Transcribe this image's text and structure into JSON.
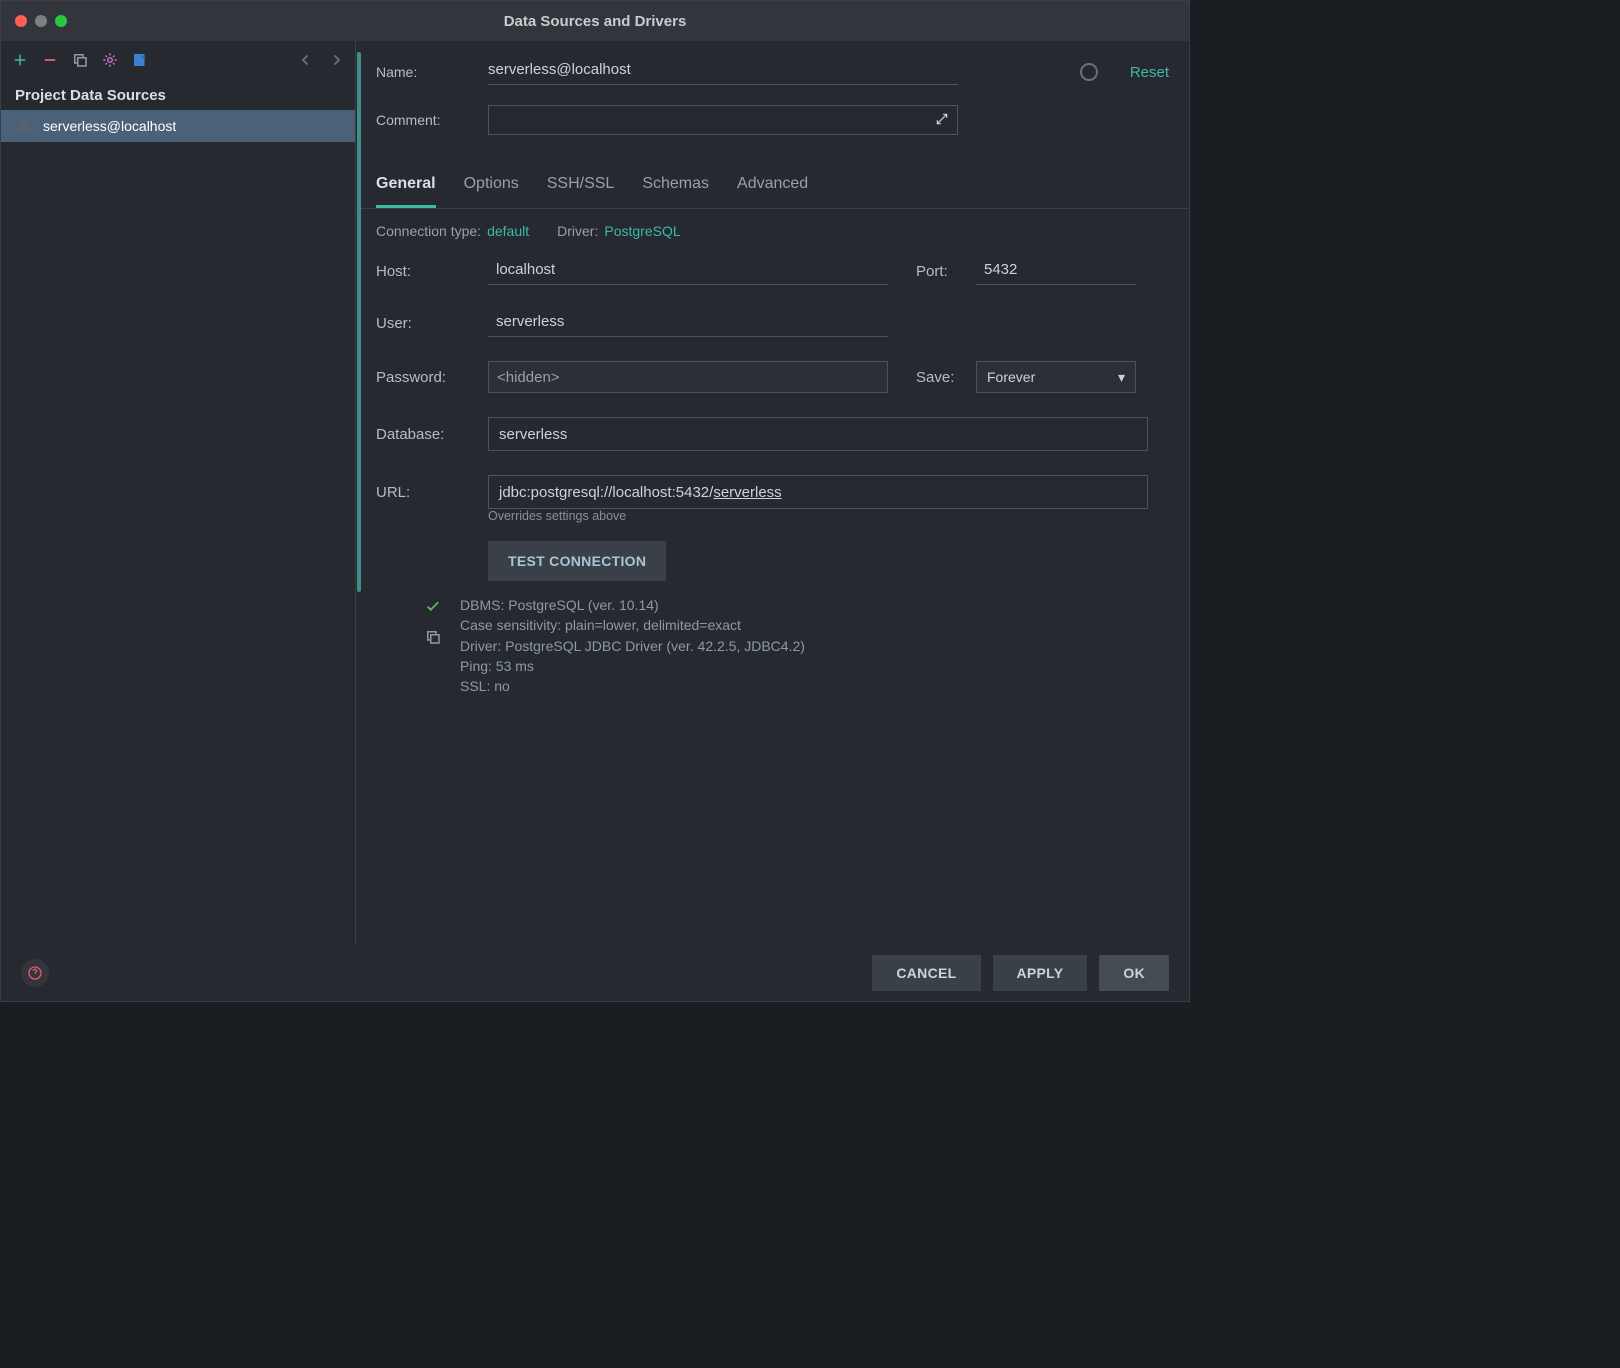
{
  "window": {
    "title": "Data Sources and Drivers"
  },
  "sidebar": {
    "tree_header": "Project Data Sources",
    "items": [
      {
        "label": "serverless@localhost"
      }
    ]
  },
  "header": {
    "name_label": "Name:",
    "name_value": "serverless@localhost",
    "comment_label": "Comment:",
    "reset": "Reset"
  },
  "tabs": [
    {
      "label": "General",
      "active": true
    },
    {
      "label": "Options"
    },
    {
      "label": "SSH/SSL"
    },
    {
      "label": "Schemas"
    },
    {
      "label": "Advanced"
    }
  ],
  "subinfo": {
    "conn_type_label": "Connection type:",
    "conn_type_value": "default",
    "driver_label": "Driver:",
    "driver_value": "PostgreSQL"
  },
  "form": {
    "host_label": "Host:",
    "host_value": "localhost",
    "port_label": "Port:",
    "port_value": "5432",
    "user_label": "User:",
    "user_value": "serverless",
    "password_label": "Password:",
    "password_value": "<hidden>",
    "save_label": "Save:",
    "save_value": "Forever",
    "database_label": "Database:",
    "database_value": "serverless",
    "url_label": "URL:",
    "url_prefix": "jdbc:postgresql://localhost:5432/",
    "url_db": "serverless",
    "url_helper": "Overrides settings above",
    "test_btn": "TEST CONNECTION",
    "status": {
      "line1": "DBMS: PostgreSQL (ver. 10.14)",
      "line2": "Case sensitivity: plain=lower, delimited=exact",
      "line3": "Driver: PostgreSQL JDBC Driver (ver. 42.2.5, JDBC4.2)",
      "line4": "Ping: 53 ms",
      "line5": "SSL: no"
    }
  },
  "footer": {
    "cancel": "CANCEL",
    "apply": "APPLY",
    "ok": "OK"
  }
}
